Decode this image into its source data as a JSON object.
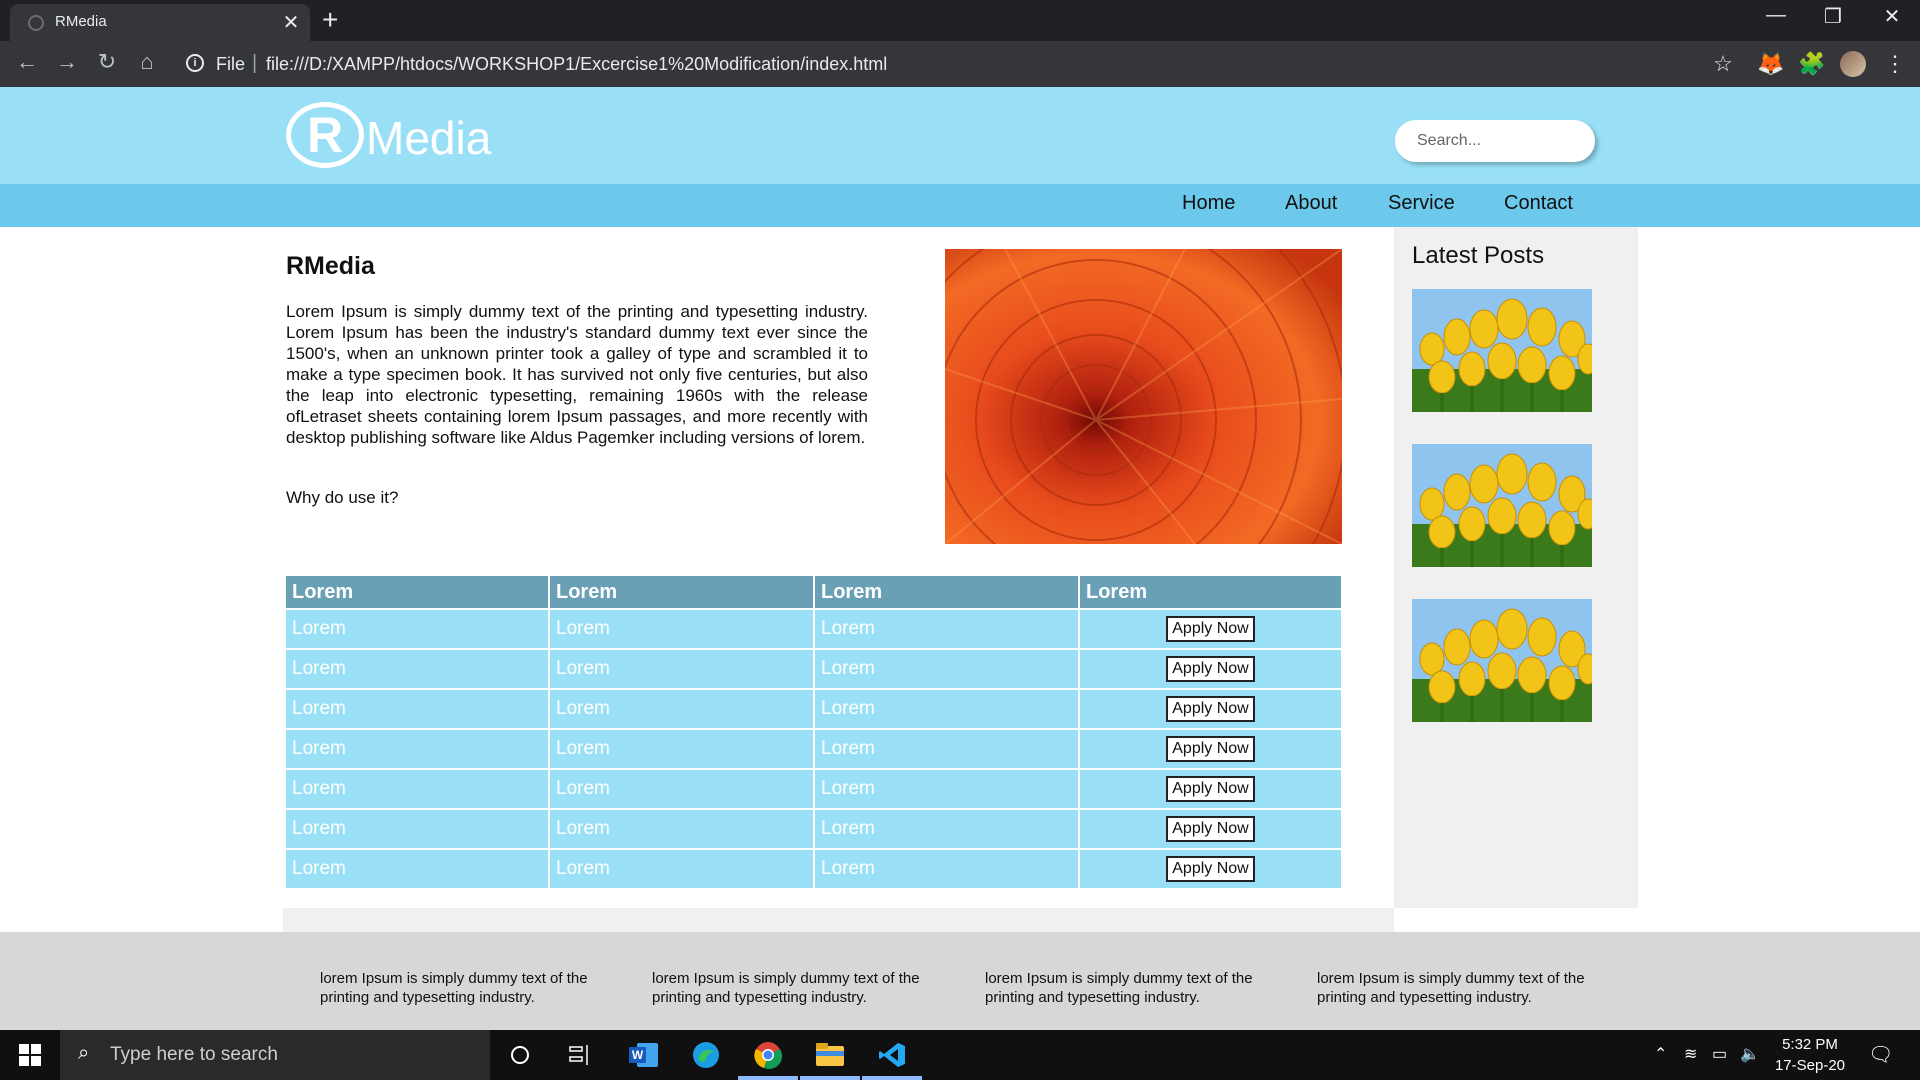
{
  "browser": {
    "tab_title": "RMedia",
    "tab_close": "✕",
    "new_tab": "+",
    "url_scheme_label": "File",
    "url_separator": "|",
    "url": "file:///D:/XAMPP/htdocs/WORKSHOP1/Excercise1%20Modification/index.html",
    "window_controls": {
      "minimize": "—",
      "restore": "❐",
      "close": "✕"
    },
    "nav": {
      "back": "←",
      "forward": "→",
      "reload": "↻",
      "home": "⌂"
    },
    "icons": {
      "bookmark": "☆",
      "metamask": "🦊",
      "extensions": "🧩",
      "menu": "⋮"
    }
  },
  "site": {
    "logo_mark": "R",
    "logo_text": "Media",
    "search": {
      "placeholder": "Search..."
    },
    "nav": [
      "Home",
      "About",
      "Service",
      "Contact"
    ],
    "main": {
      "title": "RMedia",
      "paragraph": "Lorem Ipsum is simply dummy text of the printing and typesetting industry. Lorem Ipsum has been the industry's standard dummy text ever since the 1500's, when an unknown printer took a galley of type and scrambled it to make a type specimen book. It has survived not only five centuries, but also the leap into electronic typesetting, remaining 1960s with the release ofLetraset sheets containing lorem Ipsum passages, and more recently with desktop publishing software like Aldus Pagemker including versions of lorem.",
      "subheading": "Why do use it?"
    },
    "table": {
      "headers": [
        "Lorem",
        "Lorem",
        "Lorem",
        "Lorem"
      ],
      "rows": [
        [
          "Lorem",
          "Lorem",
          "Lorem",
          "Apply Now"
        ],
        [
          "Lorem",
          "Lorem",
          "Lorem",
          "Apply Now"
        ],
        [
          "Lorem",
          "Lorem",
          "Lorem",
          "Apply Now"
        ],
        [
          "Lorem",
          "Lorem",
          "Lorem",
          "Apply Now"
        ],
        [
          "Lorem",
          "Lorem",
          "Lorem",
          "Apply Now"
        ],
        [
          "Lorem",
          "Lorem",
          "Lorem",
          "Apply Now"
        ],
        [
          "Lorem",
          "Lorem",
          "Lorem",
          "Apply Now"
        ]
      ]
    },
    "sidebar": {
      "title": "Latest Posts"
    },
    "footer": [
      "lorem Ipsum is simply dummy text of the printing and typesetting industry.",
      "lorem Ipsum is simply dummy text of the printing and typesetting industry.",
      "lorem Ipsum is simply dummy text of the printing and typesetting industry.",
      "lorem Ipsum is simply dummy text of the printing and typesetting industry."
    ],
    "colors": {
      "header": "#99e0f7",
      "nav": "#6cc9eb",
      "table_header": "#6aa0b5",
      "table_cell": "#99e0f7",
      "footer": "#d7d7d7"
    }
  },
  "taskbar": {
    "search_placeholder": "Type here to search",
    "apps": [
      "start-icon",
      "cortana-icon",
      "task-view-icon",
      "word-icon",
      "edge-icon",
      "chrome-icon",
      "file-explorer-icon",
      "vscode-icon"
    ],
    "clock": {
      "time": "5:32 PM",
      "date": "17-Sep-20"
    }
  }
}
